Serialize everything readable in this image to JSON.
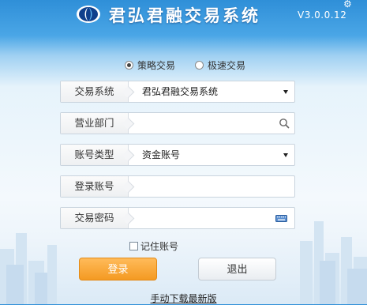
{
  "header": {
    "title": "君弘君融交易系统",
    "version": "V3.0.0.12"
  },
  "mode": {
    "options": [
      {
        "label": "策略交易",
        "selected": true
      },
      {
        "label": "极速交易",
        "selected": false
      }
    ]
  },
  "form": {
    "system": {
      "label": "交易系统",
      "value": "君弘君融交易系统"
    },
    "branch": {
      "label": "营业部门",
      "value": ""
    },
    "account_type": {
      "label": "账号类型",
      "value": "资金账号"
    },
    "login_account": {
      "label": "登录账号",
      "value": ""
    },
    "password": {
      "label": "交易密码",
      "value": ""
    }
  },
  "remember": {
    "label": "记住账号",
    "checked": false
  },
  "buttons": {
    "login": "登录",
    "exit": "退出"
  },
  "download_link": "手动下载最新版",
  "colors": {
    "header_blue": "#2f8fd8",
    "login_orange": "#f49a22"
  },
  "icons": [
    "logo-icon",
    "search-icon",
    "keyboard-icon",
    "dropdown-caret-icon",
    "settings-icon"
  ]
}
